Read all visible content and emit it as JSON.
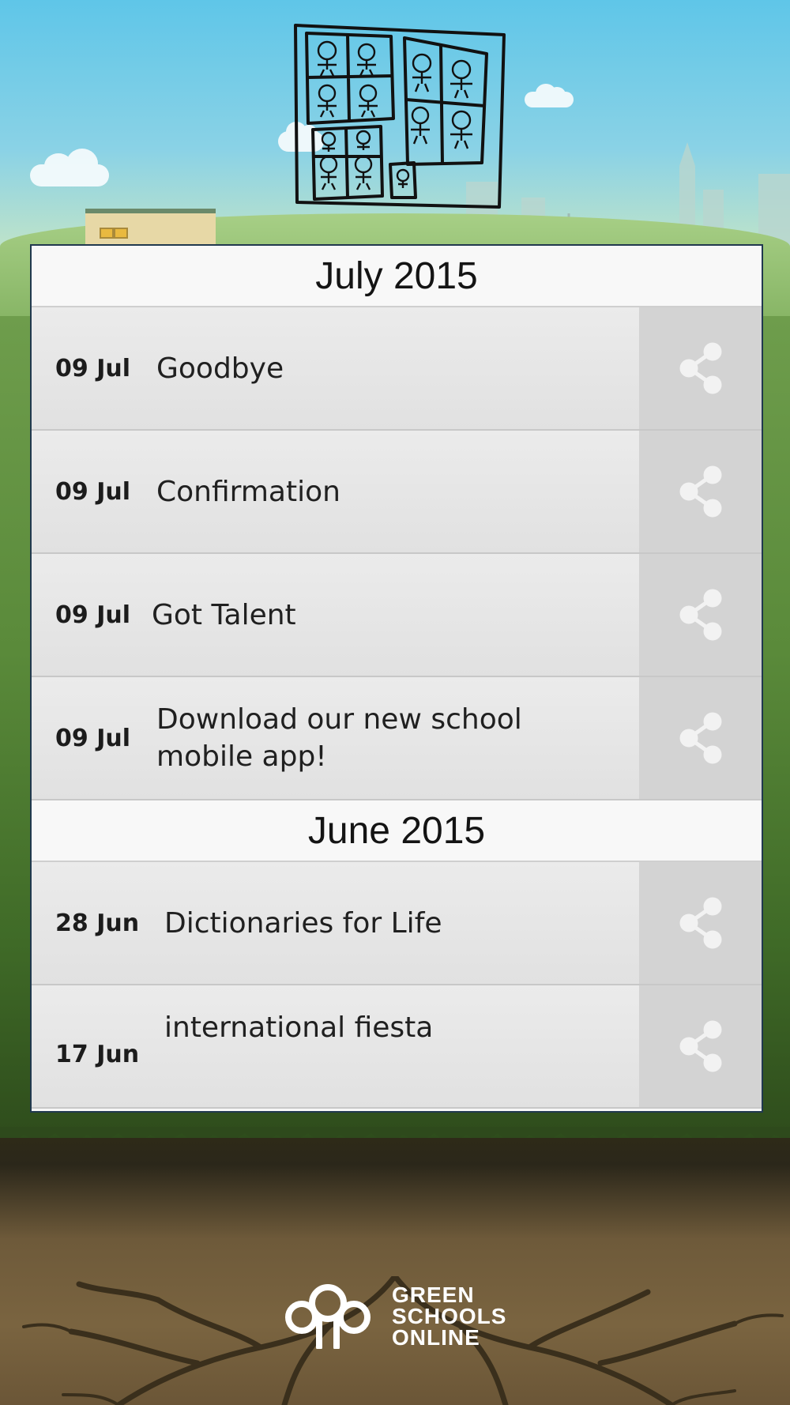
{
  "app": {
    "brand_lines": [
      "GREEN",
      "SCHOOLS",
      "ONLINE"
    ]
  },
  "icons": {
    "share": "share-icon",
    "logo": "school-logo-drawing",
    "brand": "green-schools-online-logo"
  },
  "colors": {
    "panel_border": "#21394f",
    "share_bg": "#d3d3d3",
    "row_bg": "#e6e6e6"
  },
  "sections": [
    {
      "month": "July 2015",
      "items": [
        {
          "date": "09 Jul",
          "title": "Goodbye"
        },
        {
          "date": "09 Jul",
          "title": "Confirmation"
        },
        {
          "date": "09 Jul",
          "title": "Got Talent"
        },
        {
          "date": "09 Jul",
          "title": "Download our new school mobile app!"
        }
      ]
    },
    {
      "month": "June 2015",
      "items": [
        {
          "date": "28 Jun",
          "title": "Dictionaries for Life"
        },
        {
          "date": "17 Jun",
          "title": "international fiesta"
        }
      ]
    }
  ]
}
